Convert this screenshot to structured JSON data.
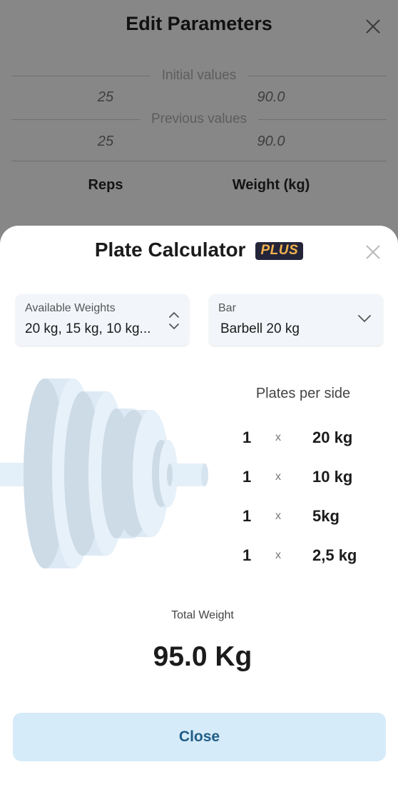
{
  "background": {
    "title": "Edit Parameters",
    "initial_label": "Initial values",
    "initial_reps": "25",
    "initial_weight": "90.0",
    "previous_label": "Previous values",
    "previous_reps": "25",
    "previous_weight": "90.0",
    "col_reps": "Reps",
    "col_weight": "Weight (kg)"
  },
  "sheet": {
    "title": "Plate Calculator",
    "badge": "PLUS",
    "available_weights": {
      "label": "Available Weights",
      "value": "20 kg, 15 kg, 10 kg..."
    },
    "bar": {
      "label": "Bar",
      "value": "Barbell 20 kg"
    },
    "plates_title": "Plates per side",
    "multiply_symbol": "x",
    "plates": [
      {
        "count": "1",
        "weight": "20 kg"
      },
      {
        "count": "1",
        "weight": "10 kg"
      },
      {
        "count": "1",
        "weight": "5kg"
      },
      {
        "count": "1",
        "weight": "2,5 kg"
      }
    ],
    "total_label": "Total Weight",
    "total_value": "95.0 Kg",
    "close_label": "Close"
  },
  "icons": {
    "close": "close-icon",
    "updown": "chevron-up-down-icon",
    "dropdown": "chevron-down-icon"
  },
  "colors": {
    "accent_button_bg": "#d6ebf9",
    "accent_button_text": "#1f5d86",
    "badge_bg": "#25253a",
    "badge_text": "#f2b24e"
  }
}
